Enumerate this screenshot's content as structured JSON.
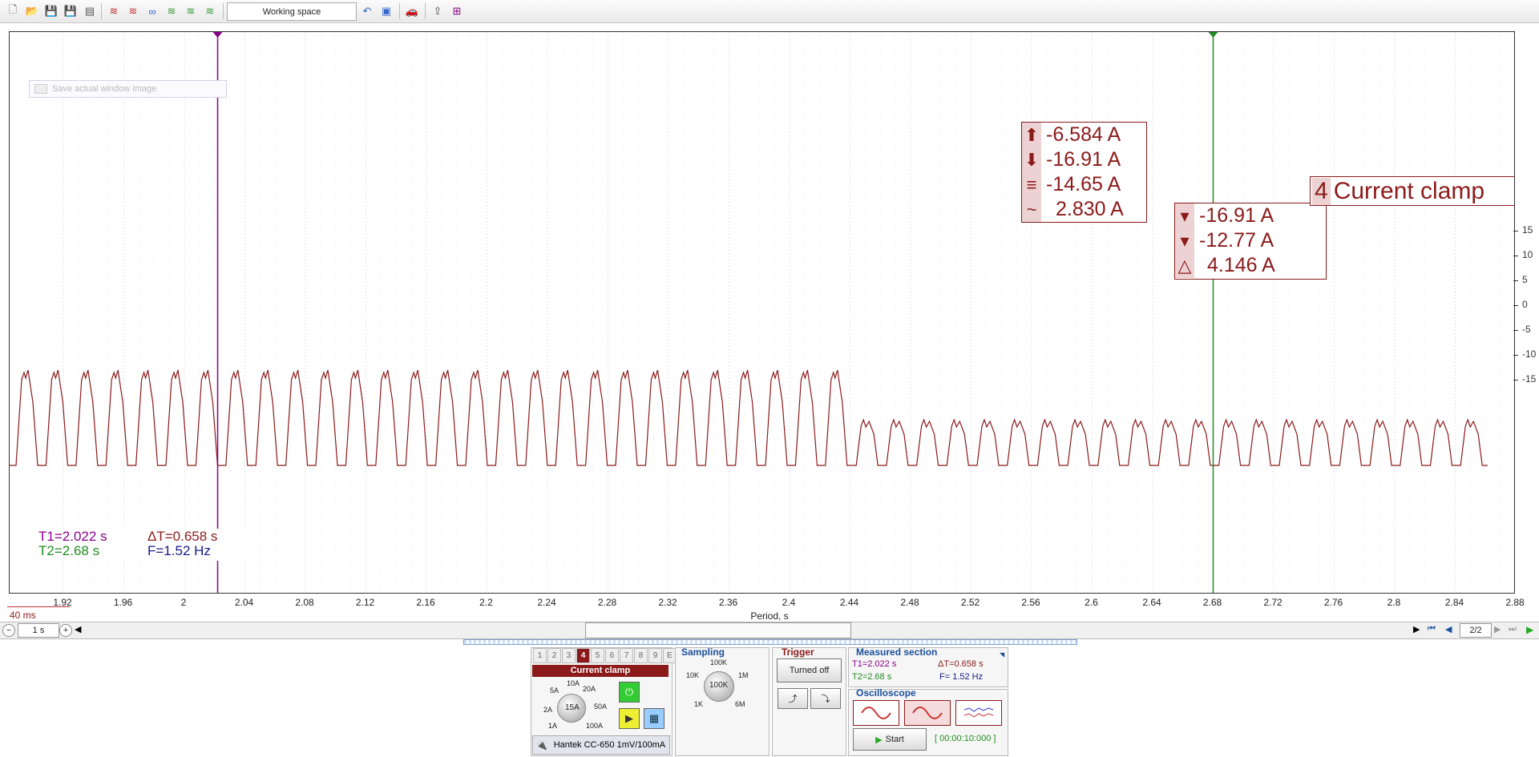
{
  "toolbar": {
    "icons": [
      "new-file-icon",
      "open-folder-icon",
      "save-icon",
      "save-as-icon",
      "print-icon",
      "channels-icon",
      "channels-off-icon",
      "channels-sync-icon",
      "channels-check-icon",
      "channels-check2-icon",
      "channels-check3-icon"
    ],
    "workspace_label": "Working space",
    "extra_icons": [
      "undo-icon",
      "save-workspace-icon",
      "car-icon",
      "export-icon",
      "fit-window-icon"
    ]
  },
  "plot": {
    "save_image_label": "Save actual window image",
    "measure_box_1": {
      "max": "-6.584 A",
      "min": "-16.91 A",
      "avg": "-14.65 A",
      "rms": "2.830 A"
    },
    "measure_box_2": {
      "c1": "-16.91 A",
      "c2": "-12.77 A",
      "delta": "4.146 A"
    },
    "channel_label": {
      "number": "4",
      "name": "Current clamp"
    },
    "cursors": {
      "t1": "T1=2.022 s",
      "t2": "T2=2.68 s",
      "dt": "ΔT=0.658 s",
      "freq": "F=1.52 Hz"
    },
    "colors": {
      "trace": "#8b1a1a",
      "cursor1": "#8b008b",
      "cursor2": "#228b22"
    }
  },
  "yaxis_ticks": [
    "15",
    "10",
    "5",
    "0",
    "-5",
    "-10",
    "-15"
  ],
  "xaxis": {
    "ticks": [
      "1.92",
      "1.96",
      "2",
      "2.04",
      "2.08",
      "2.12",
      "2.16",
      "2.2",
      "2.24",
      "2.28",
      "2.32",
      "2.36",
      "2.4",
      "2.44",
      "2.48",
      "2.52",
      "2.56",
      "2.6",
      "2.64",
      "2.68",
      "2.72",
      "2.76",
      "2.8",
      "2.84",
      "2.88"
    ],
    "label": "Period, s",
    "scale_label": "40 ms"
  },
  "navbar": {
    "timebase": "1 s",
    "page": "2/2"
  },
  "channel_panel": {
    "tabs": [
      "1",
      "2",
      "3",
      "4",
      "5",
      "6",
      "7",
      "8",
      "9",
      "E"
    ],
    "active_tab": "4",
    "title": "Current clamp",
    "knob_value": "15A",
    "knob_labels": [
      "10A",
      "20A",
      "5A",
      "50A",
      "2A",
      "100A",
      "1A"
    ],
    "probe": "Hantek CC-650  1mV/100mA"
  },
  "sampling": {
    "title": "Sampling",
    "value": "100K",
    "labels": [
      "100K",
      "10K",
      "1M",
      "1K",
      "6M"
    ]
  },
  "trigger": {
    "title": "Trigger",
    "button": "Turned off"
  },
  "measured": {
    "title": "Measured section",
    "t1": "T1=2.022 s",
    "dt": "ΔT=0.658 s",
    "t2": "T2=2.68 s",
    "freq": "F= 1.52 Hz"
  },
  "oscilloscope": {
    "title": "Oscilloscope",
    "start": "Start",
    "timer": "[ 00:00:10:000 ]"
  }
}
